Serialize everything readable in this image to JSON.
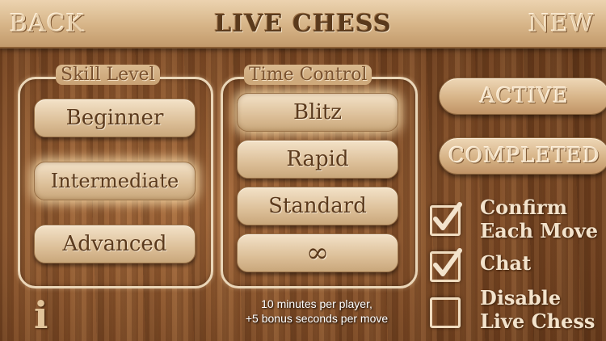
{
  "header": {
    "back_label": "BACK",
    "title": "LIVE CHESS",
    "new_label": "NEW"
  },
  "skill_level": {
    "label": "Skill Level",
    "options": [
      "Beginner",
      "Intermediate",
      "Advanced"
    ],
    "selected": "Intermediate"
  },
  "time_control": {
    "label": "Time Control",
    "options": [
      "Blitz",
      "Rapid",
      "Standard",
      "∞"
    ],
    "selected": "Blitz",
    "description": "10 minutes per player,\n+5 bonus seconds per move"
  },
  "games": {
    "active_label": "ACTIVE",
    "completed_label": "COMPLETED"
  },
  "settings": [
    {
      "label": "Confirm\nEach Move",
      "checked": true
    },
    {
      "label": "Chat",
      "checked": true
    },
    {
      "label": "Disable\nLive Chess",
      "checked": false
    }
  ],
  "info": {
    "icon": "info-icon",
    "glyph": "i"
  },
  "colors": {
    "wood_dark": "#5c3317",
    "wood_light": "#a3683a",
    "button_face": "#dcbf98",
    "text_brown": "#5b3a1d"
  }
}
